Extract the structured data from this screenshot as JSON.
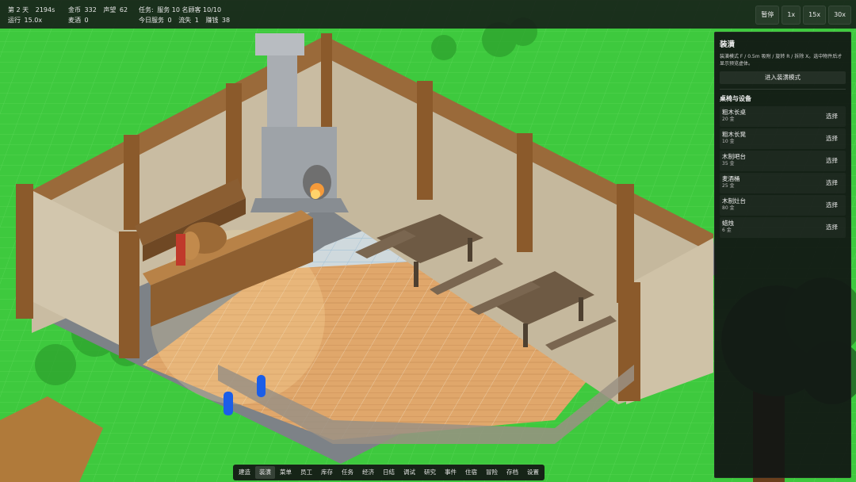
{
  "hud": {
    "day": "第 2 天",
    "time": "2194s",
    "gold_label": "金币",
    "gold": "332",
    "reputation_label": "声望",
    "reputation": "62",
    "run_label": "运行",
    "run_speed": "15.0x",
    "ale_label": "麦酒",
    "ale": "0",
    "task_label": "任务:",
    "task_text": "服务 10 名顾客 10/10",
    "today_label": "今日服务",
    "today_served": "0",
    "lost_label": "流失",
    "lost": "1",
    "tip_label": "赚钱",
    "tip": "38"
  },
  "speed_buttons": [
    "暂停",
    "1x",
    "15x",
    "30x"
  ],
  "panel": {
    "title": "装潢",
    "hint": "装潢模式 F / 0.5m 吸附 / 旋转 R / 拆除 X。选中物件后才显示预览虚体。",
    "mode_button": "进入装潢模式",
    "section_title": "桌椅与设备",
    "select_label": "选择",
    "items": [
      {
        "name": "粗木长桌",
        "price": "20 金"
      },
      {
        "name": "粗木长凳",
        "price": "10 金"
      },
      {
        "name": "木制吧台",
        "price": "35 金"
      },
      {
        "name": "麦酒桶",
        "price": "25 金"
      },
      {
        "name": "木制灶台",
        "price": "80 金"
      },
      {
        "name": "蜡烛",
        "price": "6 金"
      }
    ]
  },
  "bottom_tabs": [
    "建造",
    "装潢",
    "菜单",
    "员工",
    "库存",
    "任务",
    "经济",
    "日结",
    "调试",
    "研究",
    "事件",
    "住宿",
    "冒险",
    "存档",
    "设置"
  ],
  "active_tab": "装潢",
  "colors": {
    "grass": "#3ec93e",
    "hud_bg": "#161a18",
    "floor_wood": "#e2aa6e",
    "wall_plaster": "#c9bca2",
    "wall_wood": "#8b5a2b"
  }
}
